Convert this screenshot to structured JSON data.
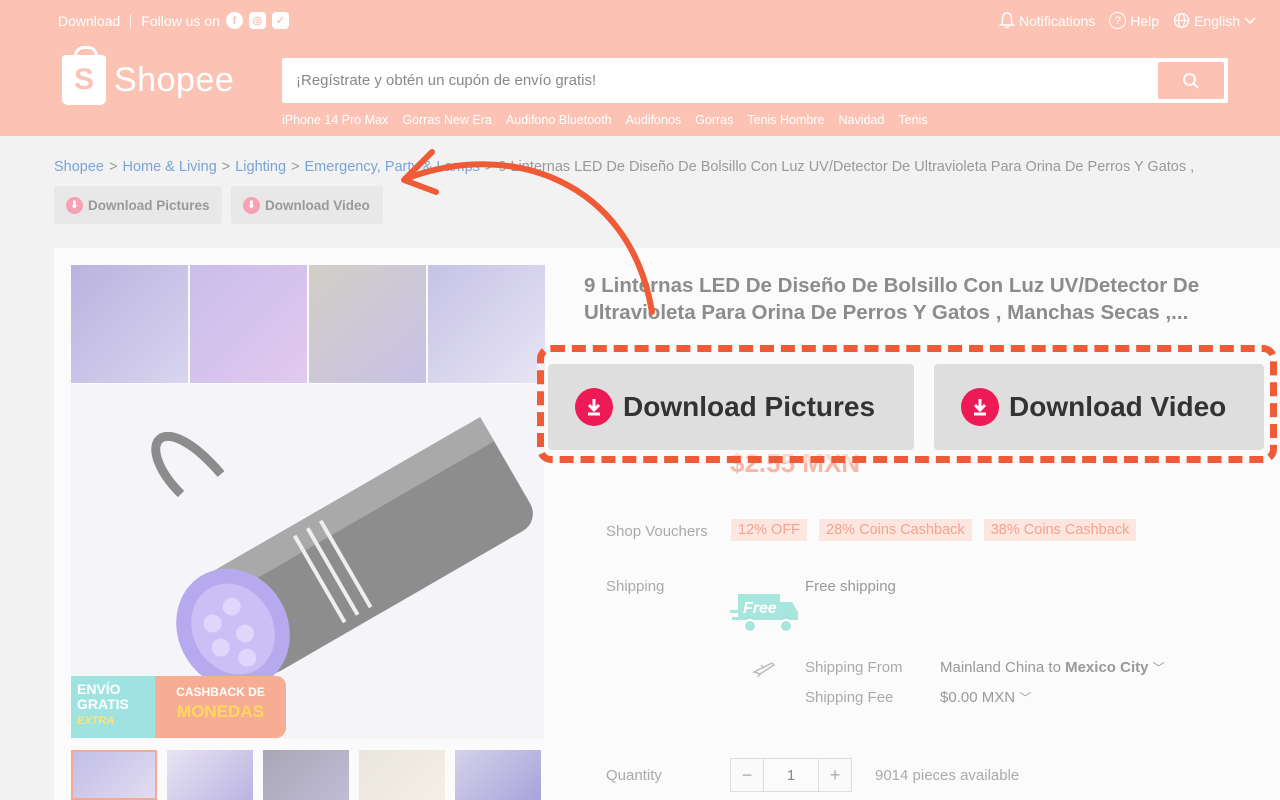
{
  "header": {
    "download_label": "Download",
    "follow_label": "Follow us on",
    "notifications_label": "Notifications",
    "help_label": "Help",
    "language_label": "English",
    "logo_text": "Shopee",
    "logo_letter": "S",
    "search_placeholder": "¡Regístrate y obtén un cupón de envío gratis!",
    "search_links": [
      "iPhone 14 Pro Max",
      "Gorras New Era",
      "Audifono Bluetooth",
      "Audifonos",
      "Gorras",
      "Tenis Hombre",
      "Navidad",
      "Tenis"
    ]
  },
  "breadcrumb": {
    "items": [
      "Shopee",
      "Home & Living",
      "Lighting",
      "Emergency, Party & Lamps"
    ],
    "current": "9 Linternas LED De Diseño De Bolsillo Con Luz UV/Detector De Ultravioleta Para Orina De Perros Y Gatos ,"
  },
  "download_buttons": {
    "pictures": "Download Pictures",
    "video": "Download Video"
  },
  "product": {
    "title": "9 Linternas LED De Diseño De Bolsillo Con Luz UV/Detector De Ultravioleta Para Orina De Perros Y Gatos , Manchas Secas ,...",
    "banner_left": "ENVÍO GRATIS",
    "banner_left_extra": "EXTRA",
    "banner_right_top": "CASHBACK DE",
    "banner_right_big": "MONEDAS",
    "shop_vouchers_label": "Shop Vouchers",
    "vouchers": [
      "12% OFF",
      "28% Coins Cashback",
      "38% Coins Cashback"
    ],
    "shipping_label": "Shipping",
    "free_shipping": "Free shipping",
    "free_badge": "Free",
    "shipping_from_label": "Shipping From",
    "shipping_from_origin": "Mainland China to",
    "shipping_destination": "Mexico City",
    "shipping_fee_label": "Shipping Fee",
    "shipping_fee": "$0.00 MXN",
    "quantity_label": "Quantity",
    "quantity": "1",
    "stock": "9014 pieces available"
  },
  "colors": {
    "header_bg": "#fcc3b5",
    "highlight": "#ef5b36",
    "download_icon": "#ee1a55"
  }
}
